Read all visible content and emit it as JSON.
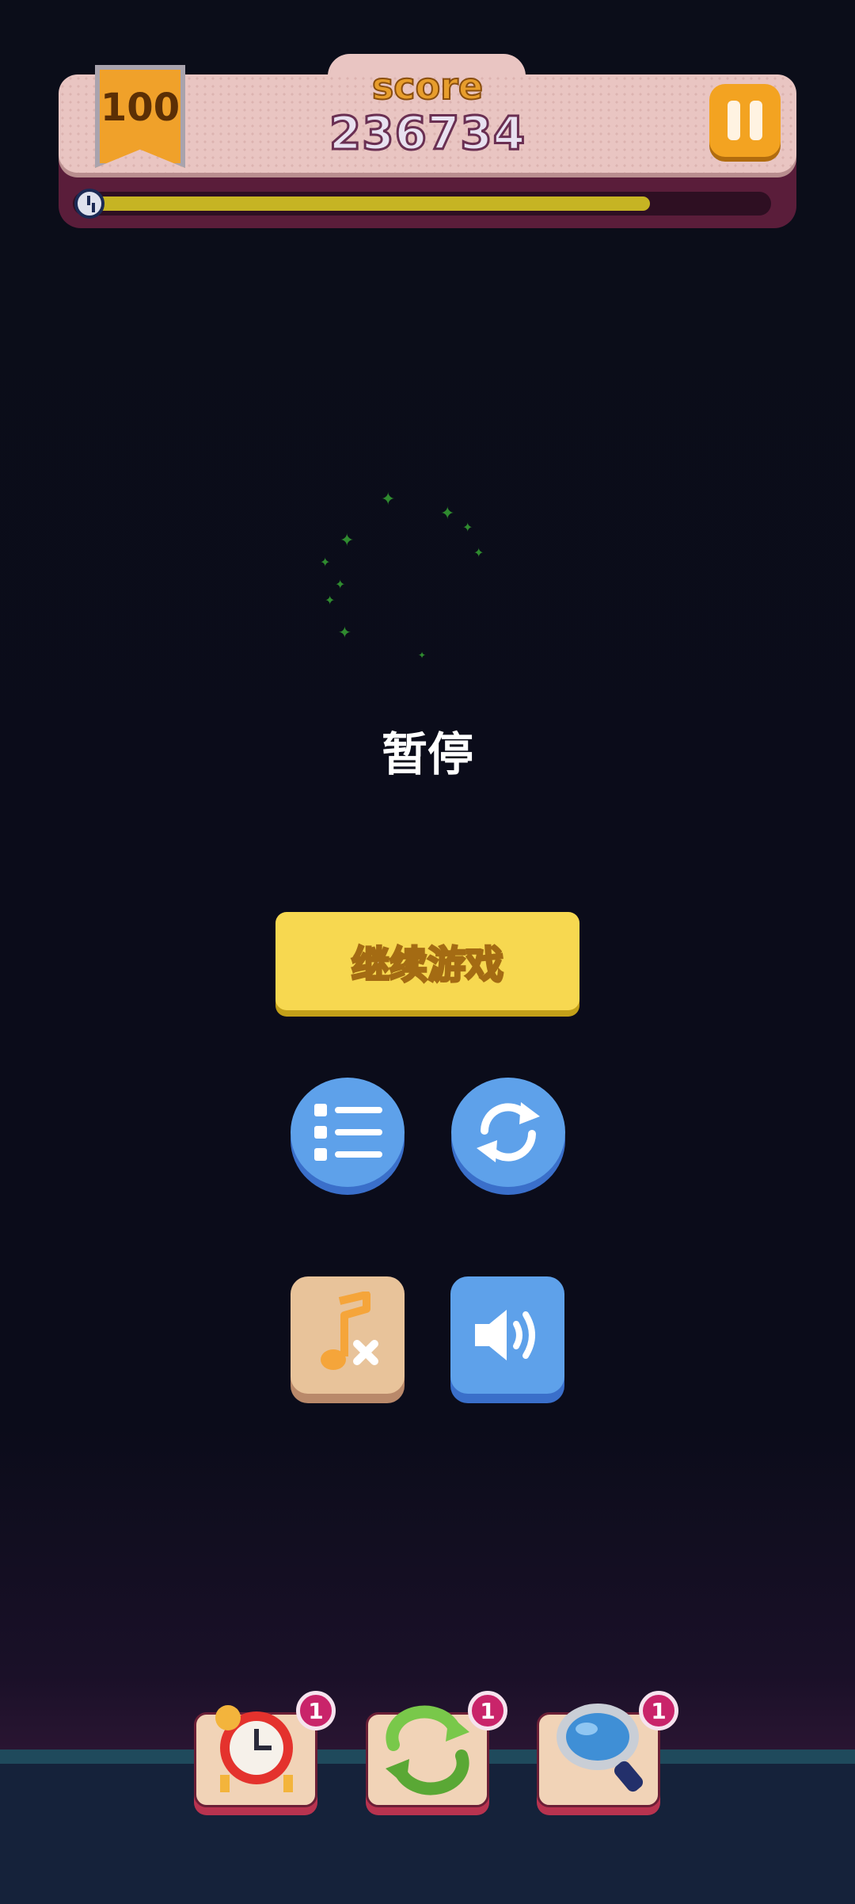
{
  "header": {
    "level": "100",
    "score_label": "score",
    "score_value": "236734",
    "timer_fraction": 0.84
  },
  "pause_menu": {
    "title": "暂停",
    "continue_label": "继续游戏"
  },
  "buttons": {
    "menu": "list-icon",
    "restart": "refresh-icon",
    "music": "music-muted-icon",
    "sound": "speaker-icon"
  },
  "boosters": [
    {
      "name": "alarm-clock",
      "count": "1"
    },
    {
      "name": "shuffle",
      "count": "1"
    },
    {
      "name": "magnifier",
      "count": "1"
    }
  ],
  "colors": {
    "background": "#0b0d19",
    "continue_button": "#f7d850",
    "blue_button": "#5ea1ea",
    "music_button": "#e8c39a",
    "timer_fill": "#c6b423"
  }
}
